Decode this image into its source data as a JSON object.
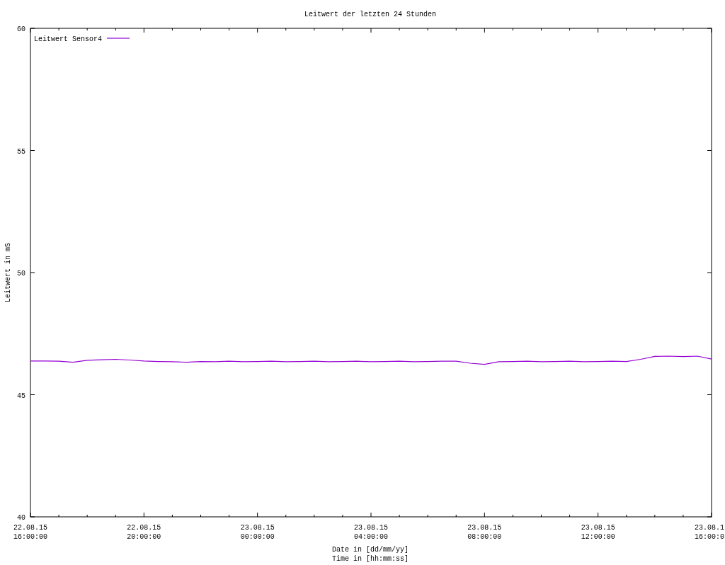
{
  "chart_data": {
    "type": "line",
    "title": "Leitwert der letzten 24 Stunden",
    "xlabel": "Date in [dd/mm/yy]\nTime in [hh:mm:ss]",
    "ylabel": "Leitwert in mS",
    "categories": [
      "22.08.15\n16:00:00",
      null,
      null,
      null,
      null,
      null,
      null,
      null,
      "22.08.15\n20:00:00",
      null,
      null,
      null,
      null,
      null,
      null,
      null,
      "23.08.15\n00:00:00",
      null,
      null,
      null,
      null,
      null,
      null,
      null,
      "23.08.15\n04:00:00",
      null,
      null,
      null,
      null,
      null,
      null,
      null,
      "23.08.15\n08:00:00",
      null,
      null,
      null,
      null,
      null,
      null,
      null,
      "23.08.15\n12:00:00",
      null,
      null,
      null,
      null,
      null,
      null,
      null,
      "23.08.1\n16:00:0"
    ],
    "series": [
      {
        "name": "Leitwert Sensor4",
        "color": "#9400d3",
        "values": [
          46.38,
          46.38,
          46.37,
          46.33,
          46.41,
          46.43,
          46.45,
          46.42,
          46.38,
          46.36,
          46.35,
          46.33,
          46.36,
          46.35,
          46.37,
          46.35,
          46.36,
          46.37,
          46.35,
          46.36,
          46.37,
          46.35,
          46.36,
          46.37,
          46.35,
          46.36,
          46.37,
          46.35,
          46.36,
          46.37,
          46.37,
          46.29,
          46.24,
          46.35,
          46.36,
          46.37,
          46.35,
          46.36,
          46.37,
          46.35,
          46.36,
          46.37,
          46.36,
          46.45,
          46.57,
          46.58,
          46.56,
          46.58,
          46.46
        ]
      }
    ],
    "ylim": [
      40,
      60
    ],
    "yticks": [
      40,
      45,
      50,
      55,
      60
    ]
  }
}
